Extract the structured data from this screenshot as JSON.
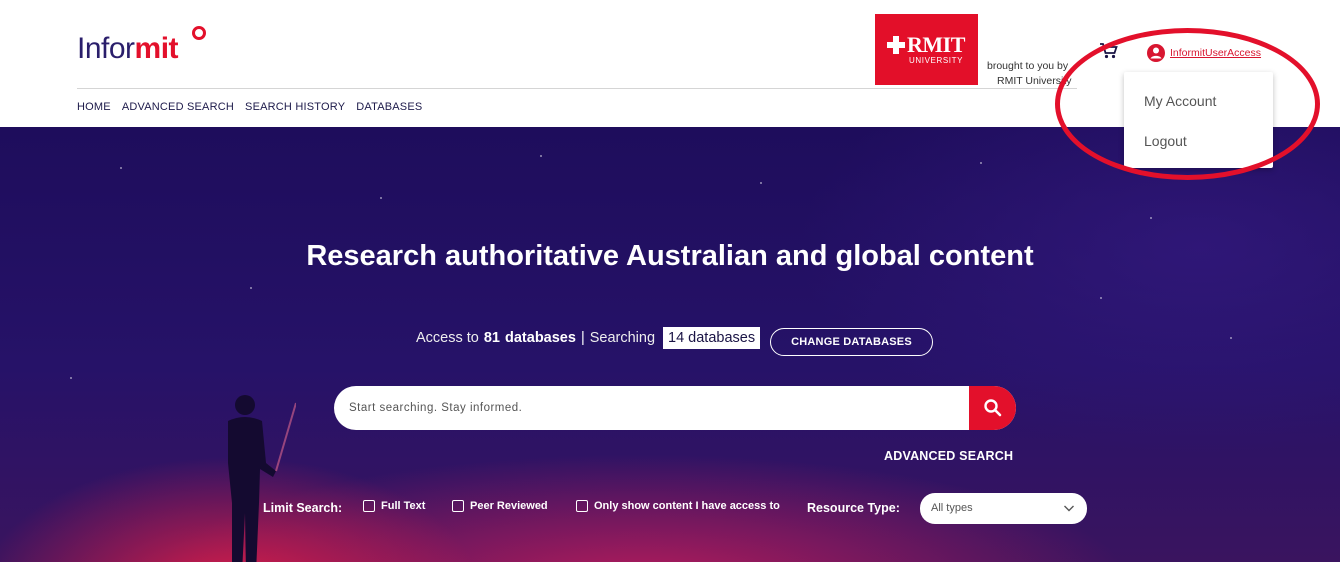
{
  "brand": {
    "logo_part1": "Infor",
    "logo_part2": "mit",
    "accent_color": "#e3102b",
    "navy_color": "#1e0d5c"
  },
  "nav": {
    "items": [
      "HOME",
      "ADVANCED SEARCH",
      "SEARCH HISTORY",
      "DATABASES"
    ]
  },
  "institution": {
    "logo_name": "RMIT",
    "logo_sub": "UNIVERSITY",
    "brought_line1": "brought to you by",
    "brought_line2": "RMIT University"
  },
  "header_icons": {
    "cart": "shopping-cart-icon",
    "user": "user-account-icon"
  },
  "user": {
    "link_label": "InformitUserAccess"
  },
  "user_menu": {
    "items": [
      "My Account",
      "Logout"
    ]
  },
  "hero": {
    "title": "Research authoritative Australian and global content",
    "access_prefix": "Access to",
    "access_count": "81",
    "access_databases": "databases",
    "separator": "|",
    "searching_label": "Searching",
    "searching_chip": "14 databases",
    "change_button": "CHANGE DATABASES",
    "search_placeholder": "Start searching. Stay informed.",
    "search_icon": "search-icon",
    "advanced_search_link": "ADVANCED SEARCH"
  },
  "filters": {
    "limit_label": "Limit Search:",
    "checkboxes": [
      "Full Text",
      "Peer Reviewed",
      "Only show content I have access to"
    ],
    "resource_type_label": "Resource Type:",
    "resource_type_value": "All types"
  }
}
